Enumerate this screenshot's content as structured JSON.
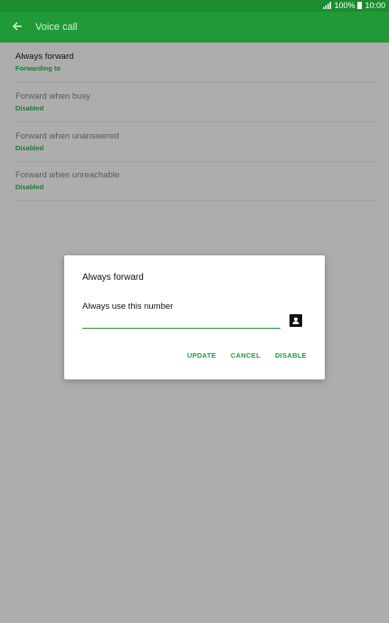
{
  "status_bar": {
    "battery": "100%",
    "time": "10:00"
  },
  "app_bar": {
    "title": "Voice call"
  },
  "settings": [
    {
      "title": "Always forward",
      "subtitle": "Forwarding to"
    },
    {
      "title": "Forward when busy",
      "subtitle": "Disabled"
    },
    {
      "title": "Forward when unanswered",
      "subtitle": "Disabled"
    },
    {
      "title": "Forward when unreachable",
      "subtitle": "Disabled"
    }
  ],
  "dialog": {
    "title": "Always forward",
    "label": "Always use this number",
    "input_value": "",
    "buttons": {
      "update": "UPDATE",
      "cancel": "CANCEL",
      "disable": "DISABLE"
    }
  },
  "colors": {
    "primary": "#1f9a36",
    "status_bar": "#1b8c2f",
    "scrim": "#adadad"
  },
  "icons": {
    "back": "arrow-back-icon",
    "contact": "contact-icon",
    "signal": "signal-icon",
    "battery": "battery-icon"
  }
}
